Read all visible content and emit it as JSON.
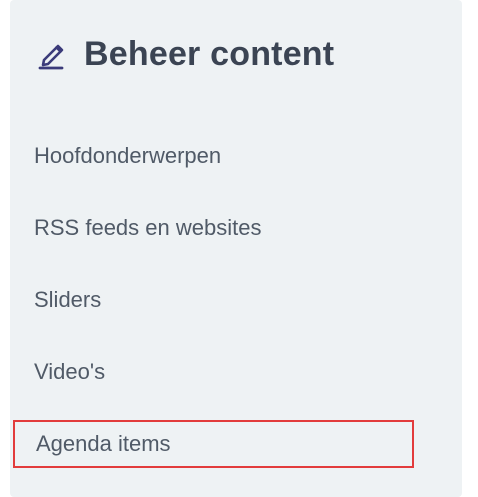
{
  "sidebar": {
    "title": "Beheer content",
    "title_icon": "pencil-icon",
    "items": [
      {
        "label": "Hoofdonderwerpen"
      },
      {
        "label": "RSS feeds en websites"
      },
      {
        "label": "Sliders"
      },
      {
        "label": "Video's"
      },
      {
        "label": "Agenda items"
      }
    ]
  },
  "colors": {
    "panel_bg": "#eef2f4",
    "title_text": "#3b4453",
    "item_text": "#505a67",
    "highlight_border": "#e23c3c",
    "icon_accent": "#3b3b7a"
  }
}
